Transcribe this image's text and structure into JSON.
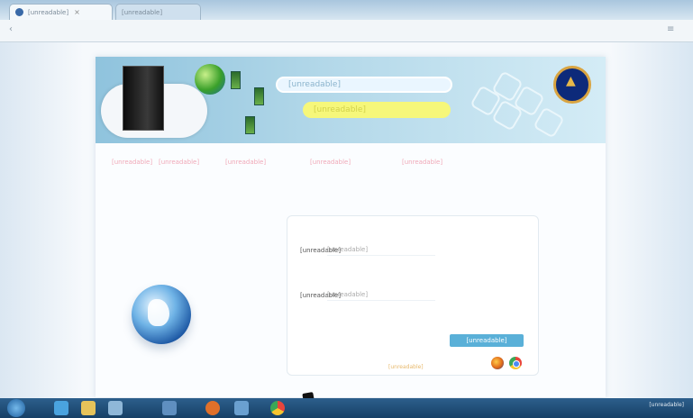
{
  "browser": {
    "tabs": [
      {
        "title": "[unreadable]",
        "active": true
      },
      {
        "title": "[unreadable]",
        "active": false
      }
    ]
  },
  "banner": {
    "title_pill": "[unreadable]",
    "subtitle_pill": "[unreadable]"
  },
  "nav": {
    "items": [
      "[unreadable]",
      "[unreadable]",
      "[unreadable]",
      "[unreadable]",
      "[unreadable]"
    ]
  },
  "login": {
    "username_label": "[unreadable]",
    "username_value": "[unreadable]",
    "password_label": "[unreadable]",
    "password_value": "[unreadable]",
    "login_button": "[unreadable]",
    "browser_note": "[unreadable]"
  },
  "taskbar": {
    "clock": "[unreadable]"
  },
  "colors": {
    "nav_link": "#f0a9b8",
    "login_button": "#5ab0d8",
    "emblem": "#0d2a7a"
  }
}
